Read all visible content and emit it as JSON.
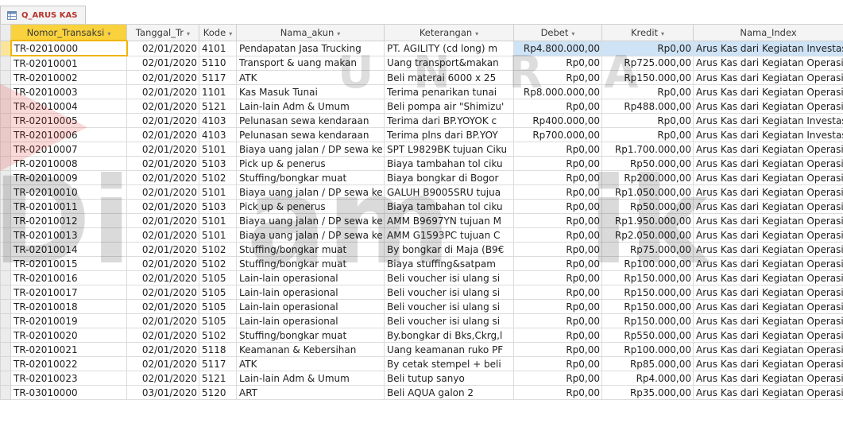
{
  "tab": {
    "label": "Q_ARUS KAS",
    "icon": "query-table-icon"
  },
  "columns": [
    {
      "label": "Nomor_Transaksi",
      "arrow": "▾"
    },
    {
      "label": "Tanggal_Tr",
      "arrow": "▾"
    },
    {
      "label": "Kode",
      "arrow": "▾"
    },
    {
      "label": "Nama_akun",
      "arrow": "▾"
    },
    {
      "label": "Keterangan",
      "arrow": "▾"
    },
    {
      "label": "Debet",
      "arrow": "▾"
    },
    {
      "label": "Kredit",
      "arrow": "▾"
    },
    {
      "label": "Nama_Index",
      "arrow": ""
    }
  ],
  "rows": [
    [
      "TR-02010000",
      "02/01/2020",
      "4101",
      "Pendapatan Jasa Trucking",
      "PT. AGILITY (cd long) m",
      "Rp4.800.000,00",
      "Rp0,00",
      "Arus Kas dari Kegiatan Investasi"
    ],
    [
      "TR-02010001",
      "02/01/2020",
      "5110",
      "Transport & uang makan",
      "Uang transport&makan",
      "Rp0,00",
      "Rp725.000,00",
      "Arus Kas dari Kegiatan Operasinal"
    ],
    [
      "TR-02010002",
      "02/01/2020",
      "5117",
      "ATK",
      "Beli materai 6000 x 25",
      "Rp0,00",
      "Rp150.000,00",
      "Arus Kas dari Kegiatan Operasinal"
    ],
    [
      "TR-02010003",
      "02/01/2020",
      "1101",
      "Kas Masuk Tunai",
      "Terima penarikan tunai",
      "Rp8.000.000,00",
      "Rp0,00",
      "Arus Kas dari Kegiatan Operasinal"
    ],
    [
      "TR-02010004",
      "02/01/2020",
      "5121",
      "Lain-lain Adm & Umum",
      "Beli pompa air \"Shimizu'",
      "Rp0,00",
      "Rp488.000,00",
      "Arus Kas dari Kegiatan Operasinal"
    ],
    [
      "TR-02010005",
      "02/01/2020",
      "4103",
      "Pelunasan sewa kendaraan",
      "Terima dari BP.YOYOK c",
      "Rp400.000,00",
      "Rp0,00",
      "Arus Kas dari Kegiatan Investasi"
    ],
    [
      "TR-02010006",
      "02/01/2020",
      "4103",
      "Pelunasan sewa kendaraan",
      "Terima plns dari BP.YOY",
      "Rp700.000,00",
      "Rp0,00",
      "Arus Kas dari Kegiatan Investasi"
    ],
    [
      "TR-02010007",
      "02/01/2020",
      "5101",
      "Biaya uang jalan / DP sewa ke",
      "SPT L9829BK tujuan Ciku",
      "Rp0,00",
      "Rp1.700.000,00",
      "Arus Kas dari Kegiatan Operasinal"
    ],
    [
      "TR-02010008",
      "02/01/2020",
      "5103",
      "Pick up & penerus",
      "Biaya tambahan tol ciku",
      "Rp0,00",
      "Rp50.000,00",
      "Arus Kas dari Kegiatan Operasinal"
    ],
    [
      "TR-02010009",
      "02/01/2020",
      "5102",
      "Stuffing/bongkar muat",
      "Biaya bongkar di Bogor",
      "Rp0,00",
      "Rp200.000,00",
      "Arus Kas dari Kegiatan Operasinal"
    ],
    [
      "TR-02010010",
      "02/01/2020",
      "5101",
      "Biaya uang jalan / DP sewa ke",
      "GALUH B9005SRU tujua",
      "Rp0,00",
      "Rp1.050.000,00",
      "Arus Kas dari Kegiatan Operasinal"
    ],
    [
      "TR-02010011",
      "02/01/2020",
      "5103",
      "Pick up & penerus",
      "Biaya tambahan tol ciku",
      "Rp0,00",
      "Rp50.000,00",
      "Arus Kas dari Kegiatan Operasinal"
    ],
    [
      "TR-02010012",
      "02/01/2020",
      "5101",
      "Biaya uang jalan / DP sewa ke",
      "AMM B9697YN tujuan M",
      "Rp0,00",
      "Rp1.950.000,00",
      "Arus Kas dari Kegiatan Operasinal"
    ],
    [
      "TR-02010013",
      "02/01/2020",
      "5101",
      "Biaya uang jalan / DP sewa ke",
      "AMM G1593PC tujuan C",
      "Rp0,00",
      "Rp2.050.000,00",
      "Arus Kas dari Kegiatan Operasinal"
    ],
    [
      "TR-02010014",
      "02/01/2020",
      "5102",
      "Stuffing/bongkar muat",
      "By bongkar di Maja (B9€",
      "Rp0,00",
      "Rp75.000,00",
      "Arus Kas dari Kegiatan Operasinal"
    ],
    [
      "TR-02010015",
      "02/01/2020",
      "5102",
      "Stuffing/bongkar muat",
      "Biaya stuffing&satpam",
      "Rp0,00",
      "Rp100.000,00",
      "Arus Kas dari Kegiatan Operasinal"
    ],
    [
      "TR-02010016",
      "02/01/2020",
      "5105",
      "Lain-lain operasional",
      "Beli voucher isi ulang si",
      "Rp0,00",
      "Rp150.000,00",
      "Arus Kas dari Kegiatan Operasinal"
    ],
    [
      "TR-02010017",
      "02/01/2020",
      "5105",
      "Lain-lain operasional",
      "Beli voucher isi ulang si",
      "Rp0,00",
      "Rp150.000,00",
      "Arus Kas dari Kegiatan Operasinal"
    ],
    [
      "TR-02010018",
      "02/01/2020",
      "5105",
      "Lain-lain operasional",
      "Beli voucher isi ulang si",
      "Rp0,00",
      "Rp150.000,00",
      "Arus Kas dari Kegiatan Operasinal"
    ],
    [
      "TR-02010019",
      "02/01/2020",
      "5105",
      "Lain-lain operasional",
      "Beli voucher isi ulang si",
      "Rp0,00",
      "Rp150.000,00",
      "Arus Kas dari Kegiatan Operasinal"
    ],
    [
      "TR-02010020",
      "02/01/2020",
      "5102",
      "Stuffing/bongkar muat",
      "By.bongkar di Bks,Ckrg,l",
      "Rp0,00",
      "Rp550.000,00",
      "Arus Kas dari Kegiatan Operasinal"
    ],
    [
      "TR-02010021",
      "02/01/2020",
      "5118",
      "Keamanan & Kebersihan",
      "Uang keamanan ruko PF",
      "Rp0,00",
      "Rp100.000,00",
      "Arus Kas dari Kegiatan Operasinal"
    ],
    [
      "TR-02010022",
      "02/01/2020",
      "5117",
      "ATK",
      "By cetak stempel + beli",
      "Rp0,00",
      "Rp85.000,00",
      "Arus Kas dari Kegiatan Operasinal"
    ],
    [
      "TR-02010023",
      "02/01/2020",
      "5121",
      "Lain-lain Adm & Umum",
      "Beli tutup sanyo",
      "Rp0,00",
      "Rp4.000,00",
      "Arus Kas dari Kegiatan Operasinal"
    ],
    [
      "TR-03010000",
      "03/01/2020",
      "5120",
      "ART",
      "Beli AQUA galon 2",
      "Rp0,00",
      "Rp35.000,00",
      "Arus Kas dari Kegiatan Operasinal"
    ]
  ],
  "selection": {
    "current_row": 0,
    "highlight_row": 0,
    "highlight_cols": [
      5,
      6,
      7
    ]
  },
  "colors": {
    "accent": "#f9d23e",
    "highlight": "#cfe3f6",
    "tab_text": "#b8332d"
  }
}
